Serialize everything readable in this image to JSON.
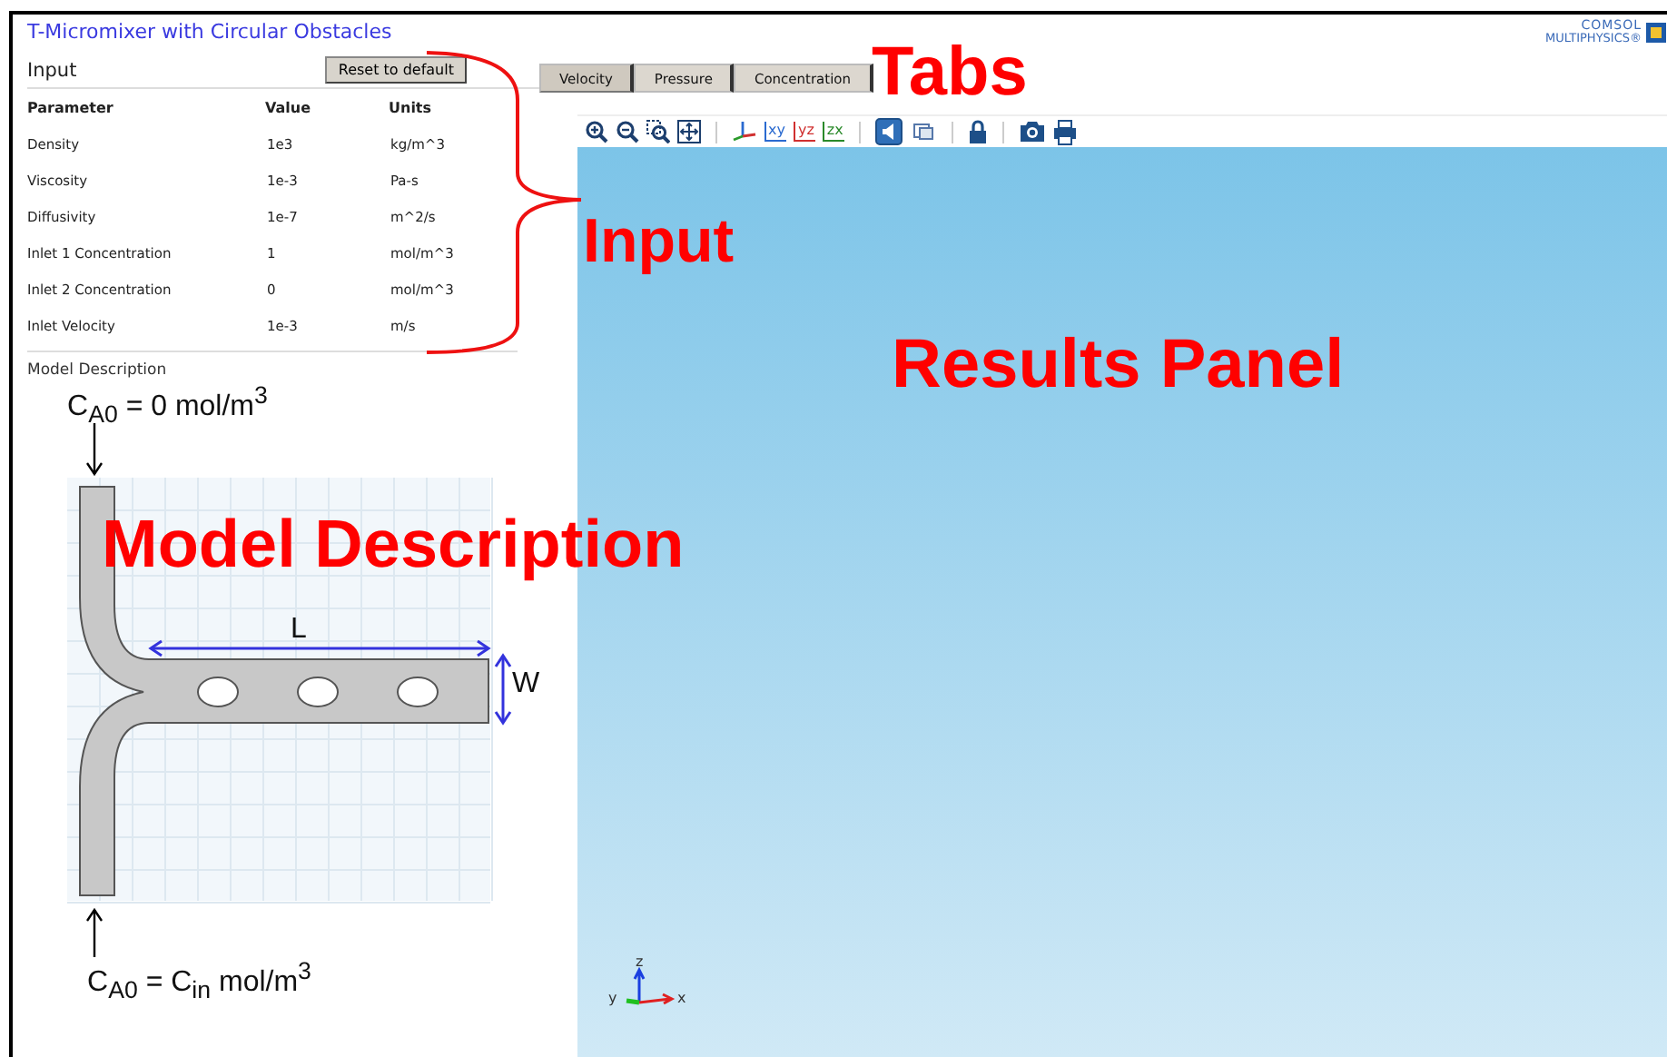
{
  "app": {
    "title": "T-Micromixer with Circular Obstacles",
    "logo": [
      "COMSOL",
      "MULTIPHYSICS®"
    ]
  },
  "input": {
    "heading": "Input",
    "reset_button": "Reset to default",
    "columns": [
      "Parameter",
      "Value",
      "Units"
    ],
    "rows": [
      [
        "Density",
        "1e3",
        "kg/m^3"
      ],
      [
        "Viscosity",
        "1e-3",
        "Pa-s"
      ],
      [
        "Diffusivity",
        "1e-7",
        "m^2/s"
      ],
      [
        "Inlet 1 Concentration",
        "1",
        "mol/m^3"
      ],
      [
        "Inlet 2 Concentration",
        "0",
        "mol/m^3"
      ],
      [
        "Inlet Velocity",
        "1e-3",
        "m/s"
      ]
    ]
  },
  "model_description": {
    "heading": "Model Description",
    "top_inlet": "C$_{A0}$ = 0 mol/m$^{3}$",
    "bottom_inlet": "C$_{A0}$ = C$_{in}$ mol/m$^{3}$",
    "length": "L",
    "width": "W"
  },
  "tabs": [
    {
      "label": "Velocity",
      "selected": true
    },
    {
      "label": "Pressure",
      "selected": false
    },
    {
      "label": "Concentration",
      "selected": false
    }
  ],
  "toolbar": [
    [
      {
        "kind": "zoom-in"
      },
      {
        "kind": "zoom-out"
      },
      {
        "kind": "zoom-box"
      },
      {
        "kind": "zoom-extents"
      }
    ],
    [
      {
        "kind": "axes"
      },
      {
        "kind": "plane",
        "label": "xy"
      },
      {
        "kind": "plane",
        "label": "yz"
      },
      {
        "kind": "plane",
        "label": "zx"
      }
    ],
    [
      {
        "kind": "toggle-light",
        "selected": true
      },
      {
        "kind": "toggle-layers",
        "selected": false
      }
    ],
    [
      {
        "kind": "lock"
      }
    ],
    [
      {
        "kind": "camera"
      },
      {
        "kind": "print"
      }
    ]
  ],
  "axis_triad": {
    "z": "z",
    "y": "y",
    "x": "x"
  },
  "annotations": [
    {
      "text": "Tabs"
    },
    {
      "text": "Input"
    },
    {
      "text": "Results Panel"
    },
    {
      "text": "Model Description"
    }
  ]
}
